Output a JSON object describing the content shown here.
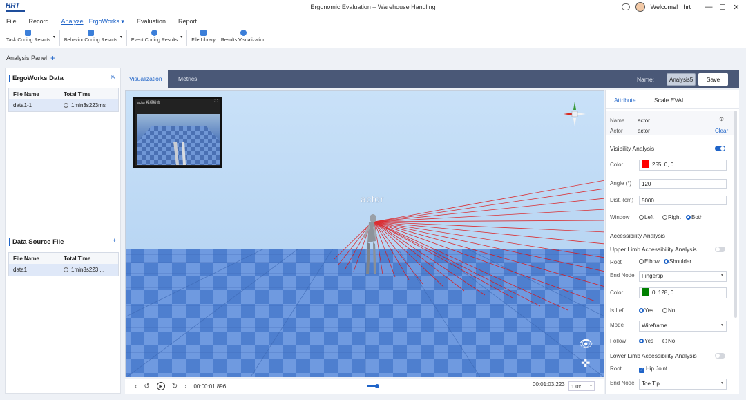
{
  "app": {
    "logo_text": "HRT",
    "window_title": "Ergonomic Evaluation – Warehouse Handling",
    "welcome": "Welcome!",
    "user": "hrt",
    "win_min": "—",
    "win_max": "☐",
    "win_close": "✕"
  },
  "menu": {
    "file": "File",
    "record": "Record",
    "analyze": "Analyze",
    "ergoworks": "ErgoWorks ▾",
    "evaluation": "Evaluation",
    "report": "Report"
  },
  "toolbar": {
    "task": "Task Coding Results",
    "behavior": "Behavior Coding Results",
    "event": "Event Coding Results",
    "library": "File Library",
    "visualization": "Results Visualization",
    "caret": "▾"
  },
  "analysis_panel": {
    "label": "Analysis Panel",
    "add": "+"
  },
  "ergoworks_data": {
    "title": "ErgoWorks Data",
    "col_name": "File Name",
    "col_time": "Total Time",
    "rows": [
      {
        "name": "data1-1",
        "time": "1min3s223ms"
      }
    ]
  },
  "data_source": {
    "title": "Data Source File",
    "add": "+",
    "col_name": "File Name",
    "col_time": "Total Time",
    "rows": [
      {
        "name": "data1",
        "time": "1min3s223 ..."
      }
    ]
  },
  "center_tabs": {
    "visualization": "Visualization",
    "metrics": "Metrics",
    "name_label": "Name:",
    "name_value": "Analysis5",
    "save": "Save"
  },
  "viewport": {
    "actor_label": "actor",
    "minimap_title": "actor 视频播放",
    "minimap_expand": "⛶"
  },
  "timeline": {
    "current": "00:00:01.896",
    "total": "00:01:03.223",
    "speed": "1.0x",
    "speed_caret": "▾"
  },
  "right_panel": {
    "tab_attribute": "Attribute",
    "tab_scale": "Scale EVAL",
    "name_label": "Name",
    "name_value": "actor",
    "actor_label": "Actor",
    "actor_value": "actor",
    "clear": "Clear",
    "visibility": {
      "title": "Visibility Analysis",
      "enabled": true,
      "color_label": "Color",
      "color_value": "255, 0, 0",
      "color_hex": "#ff0000",
      "angle_label": "Angle (°)",
      "angle_value": "120",
      "dist_label": "Dist. (cm)",
      "dist_value": "5000",
      "window_label": "Window",
      "window_options": [
        "Left",
        "Right",
        "Both"
      ],
      "window_selected": "Both"
    },
    "accessibility": {
      "title": "Accessibility Analysis",
      "upper": {
        "title": "Upper Limb Accessibility Analysis",
        "enabled": false,
        "root_label": "Root",
        "root_options": [
          "Elbow",
          "Shoulder"
        ],
        "root_selected": "Shoulder",
        "end_node_label": "End Node",
        "end_node_value": "Fingertip",
        "color_label": "Color",
        "color_value": "0, 128, 0",
        "color_hex": "#008000",
        "is_left_label": "Is Left",
        "is_left_options": [
          "Yes",
          "No"
        ],
        "is_left_selected": "Yes",
        "mode_label": "Mode",
        "mode_value": "Wireframe",
        "follow_label": "Follow",
        "follow_options": [
          "Yes",
          "No"
        ],
        "follow_selected": "Yes"
      },
      "lower": {
        "title": "Lower Limb Accessibility Analysis",
        "enabled": false,
        "root_label": "Root",
        "root_value": "Hip Joint",
        "end_node_label": "End Node",
        "end_node_value": "Toe Tip"
      }
    }
  }
}
